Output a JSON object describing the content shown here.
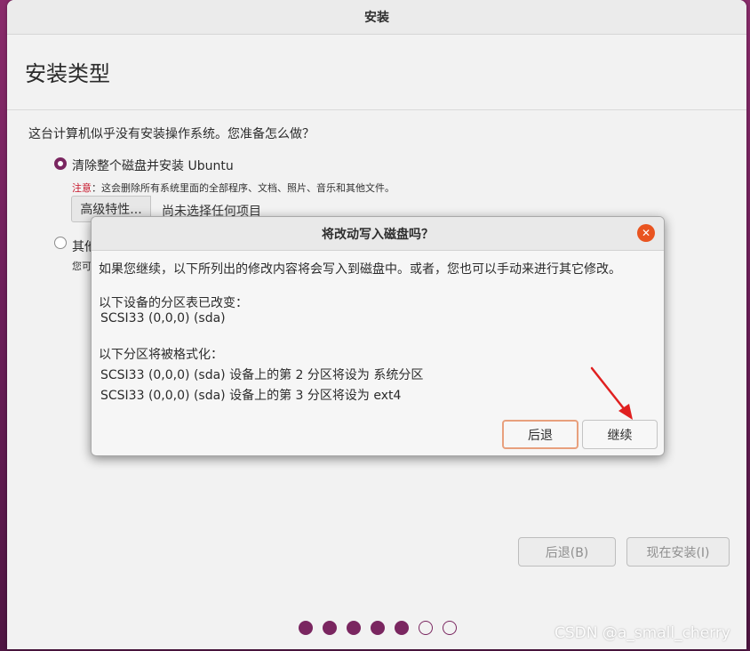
{
  "window": {
    "title": "安装"
  },
  "page": {
    "title": "安装类型"
  },
  "question": "这台计算机似乎没有安装操作系统。您准备怎么做？",
  "options": {
    "erase": {
      "label": "清除整个磁盘并安装 Ubuntu",
      "selected": true,
      "note_warning": "注意",
      "note_text": "：这会删除所有系统里面的全部程序、文档、照片、音乐和其他文件。",
      "advanced_button": "高级特性...",
      "advanced_status": "尚未选择任何项目"
    },
    "other": {
      "label": "其他",
      "subtext": "您可",
      "selected": false
    }
  },
  "nav": {
    "back_label": "后退(B)",
    "install_label": "现在安装(I)"
  },
  "progress": {
    "total": 7,
    "completed": 5
  },
  "dialog": {
    "title": "将改动写入磁盘吗？",
    "intro": "如果您继续，以下所列出的修改内容将会写入到磁盘中。或者，您也可以手动来进行其它修改。",
    "partition_table_heading": "以下设备的分区表已改变：",
    "partition_table_device": "SCSI33 (0,0,0) (sda)",
    "format_heading": "以下分区将被格式化：",
    "format_items": [
      "SCSI33 (0,0,0) (sda) 设备上的第 2 分区将设为 系统分区",
      "SCSI33 (0,0,0) (sda) 设备上的第 3 分区将设为 ext4"
    ],
    "back_label": "后退",
    "continue_label": "继续"
  },
  "watermark": "CSDN @a_small_cherry",
  "colors": {
    "accent": "#7a2660",
    "close": "#e95420",
    "warning": "#c7162b",
    "focus_border": "#e8a07d"
  }
}
